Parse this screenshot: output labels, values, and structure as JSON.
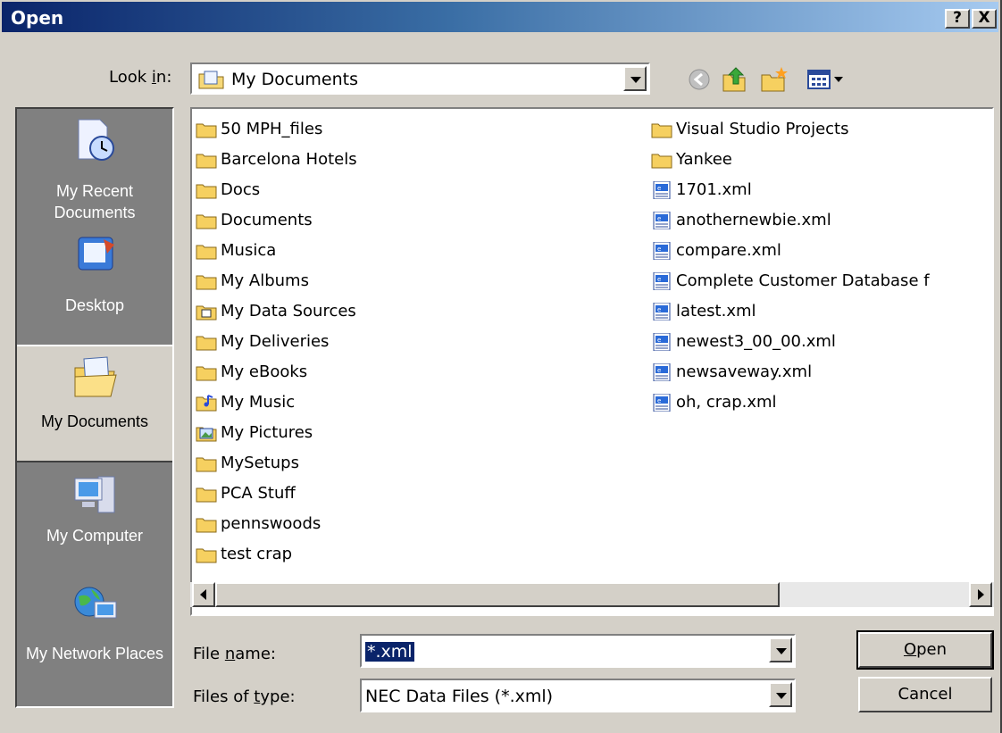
{
  "window": {
    "title": "Open",
    "help_label": "?",
    "close_label": "X"
  },
  "look_in": {
    "label_pre": "Look ",
    "label_key": "i",
    "label_post": "n:",
    "value": "My Documents"
  },
  "toolbar": {
    "icons": [
      "back-icon",
      "up-folder-icon",
      "new-folder-icon",
      "view-menu-icon"
    ]
  },
  "places": [
    {
      "label": "My Recent Documents",
      "icon": "recent-documents-icon"
    },
    {
      "label": "Desktop",
      "icon": "desktop-icon"
    },
    {
      "label": "My Documents",
      "icon": "my-documents-icon"
    },
    {
      "label": "My Computer",
      "icon": "my-computer-icon"
    },
    {
      "label": "My Network Places",
      "icon": "network-places-icon"
    }
  ],
  "files_col1": [
    {
      "name": "50 MPH_files",
      "icon": "folder"
    },
    {
      "name": "Barcelona Hotels",
      "icon": "folder"
    },
    {
      "name": "Docs",
      "icon": "folder"
    },
    {
      "name": "Documents",
      "icon": "folder"
    },
    {
      "name": "Musica",
      "icon": "folder"
    },
    {
      "name": "My Albums",
      "icon": "folder"
    },
    {
      "name": "My Data Sources",
      "icon": "datasource-folder"
    },
    {
      "name": "My Deliveries",
      "icon": "folder"
    },
    {
      "name": "My eBooks",
      "icon": "folder"
    },
    {
      "name": "My Music",
      "icon": "music-folder"
    },
    {
      "name": "My Pictures",
      "icon": "pictures-folder"
    },
    {
      "name": "MySetups",
      "icon": "folder"
    },
    {
      "name": "PCA Stuff",
      "icon": "folder"
    },
    {
      "name": "pennswoods",
      "icon": "folder"
    },
    {
      "name": "test crap",
      "icon": "folder"
    }
  ],
  "files_col2": [
    {
      "name": "Visual Studio Projects",
      "icon": "folder"
    },
    {
      "name": "Yankee",
      "icon": "folder"
    },
    {
      "name": "1701.xml",
      "icon": "xml"
    },
    {
      "name": "anothernewbie.xml",
      "icon": "xml"
    },
    {
      "name": "compare.xml",
      "icon": "xml"
    },
    {
      "name": "Complete Customer Database f",
      "icon": "xml"
    },
    {
      "name": "latest.xml",
      "icon": "xml"
    },
    {
      "name": "newest3_00_00.xml",
      "icon": "xml"
    },
    {
      "name": "newsaveway.xml",
      "icon": "xml"
    },
    {
      "name": "oh, crap.xml",
      "icon": "xml"
    }
  ],
  "file_name": {
    "label_pre": "File ",
    "label_key": "n",
    "label_post": "ame:",
    "value": "*.xml"
  },
  "file_type": {
    "label_pre": "Files of ",
    "label_key": "t",
    "label_post": "ype:",
    "value": "NEC Data Files (*.xml)"
  },
  "buttons": {
    "open_key": "O",
    "open_rest": "pen",
    "cancel": "Cancel"
  }
}
